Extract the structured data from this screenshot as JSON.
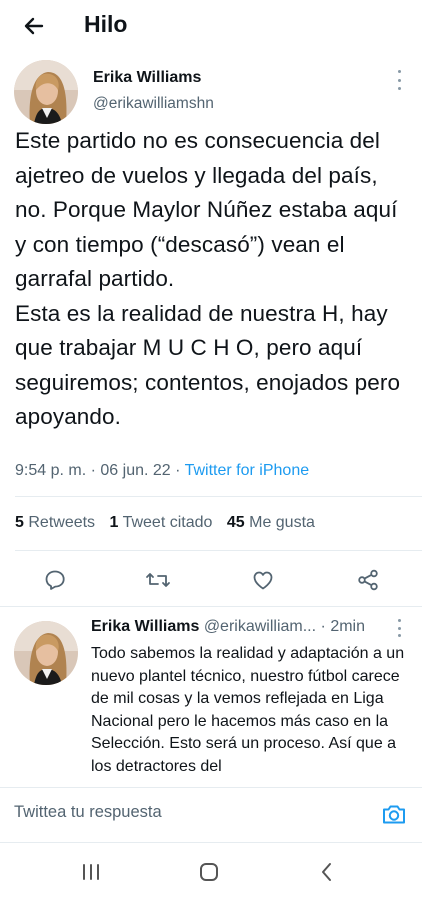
{
  "header": {
    "title": "Hilo",
    "back_icon": "arrow-left-icon"
  },
  "main_tweet": {
    "author_name": "Erika Williams",
    "author_handle": "@erikawilliamshn",
    "text": "Este partido no es consecuencia del ajetreo de vuelos y llegada del país, no. Porque Maylor Núñez estaba aquí y con tiempo (“descasó”) vean el garrafal partido.\nEsta es la realidad de nuestra H, hay que trabajar M U C H O, pero aquí seguiremos; contentos, enojados pero apoyando.",
    "time": "9:54 p. m.",
    "date": "06 jun. 22",
    "separator": "·",
    "source": "Twitter for iPhone"
  },
  "stats": {
    "retweets_count": "5",
    "retweets_label": "Retweets",
    "quotes_count": "1",
    "quotes_label": "Tweet citado",
    "likes_count": "45",
    "likes_label": "Me gusta"
  },
  "actions": {
    "reply_icon": "reply-icon",
    "retweet_icon": "retweet-icon",
    "like_icon": "heart-icon",
    "share_icon": "share-icon"
  },
  "reply_tweet": {
    "author_name": "Erika Williams",
    "author_handle": "@erikawilliam...",
    "separator": "·",
    "time": "2min",
    "text": "Todo sabemos la realidad y adaptación a un nuevo plantel técnico, nuestro fútbol carece de mil cosas y la vemos reflejada en Liga Nacional pero le hacemos más caso en la Selección. Esto será un proceso. Así que a los detractores del"
  },
  "compose": {
    "placeholder": "Twittea tu respuesta",
    "camera_icon": "camera-icon"
  },
  "navbar": {
    "recent_icon": "recent-apps-icon",
    "home_icon": "home-icon",
    "back_icon": "back-icon"
  },
  "colors": {
    "text": "#0f1419",
    "secondary": "#536471",
    "accent": "#1d9bf0",
    "divider": "#e6ecf0"
  }
}
